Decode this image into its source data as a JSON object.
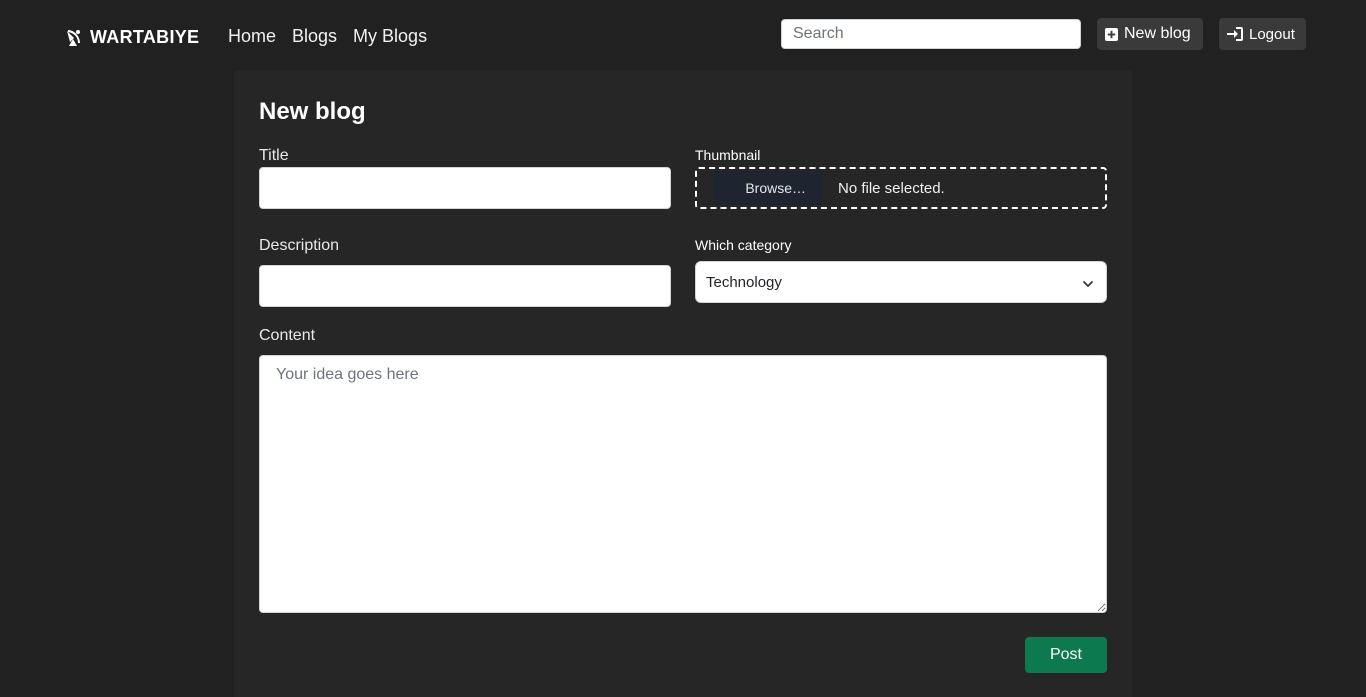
{
  "navbar": {
    "brand": "WARTABIYE",
    "brand_icon": "satellite-dish-icon",
    "links": [
      "Home",
      "Blogs",
      "My Blogs"
    ],
    "search_placeholder": "Search",
    "new_blog_label": "New blog",
    "new_blog_icon": "plus-square-icon",
    "logout_label": "Logout",
    "logout_icon": "sign-in-icon"
  },
  "form": {
    "heading": "New blog",
    "title_label": "Title",
    "title_value": "",
    "thumbnail_label": "Thumbnail",
    "browse_label": "Browse…",
    "file_status": "No file selected.",
    "description_label": "Description",
    "description_value": "",
    "category_label": "Which category",
    "category_selected": "Technology",
    "content_label": "Content",
    "content_placeholder": "Your idea goes here",
    "post_label": "Post"
  },
  "colors": {
    "background": "#212121",
    "card": "#262626",
    "post_button": "#0c7a4e"
  }
}
